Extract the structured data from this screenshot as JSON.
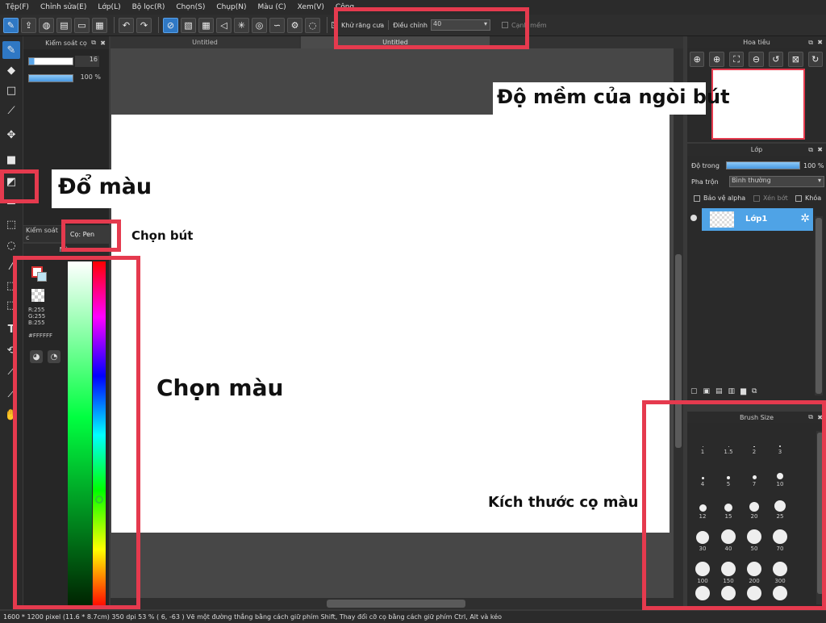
{
  "menu": [
    "Tệp(F)",
    "Chỉnh sửa(E)",
    "Lớp(L)",
    "Bộ lọc(R)",
    "Chọn(S)",
    "Chụp(N)",
    "Màu (C)",
    "Xem(V)",
    "Công"
  ],
  "toolbar": {
    "antialias_label": "Khử răng cưa",
    "adjust_label": "Điều chỉnh",
    "adjust_value": "40",
    "soft_edge_label": "Cạnh mềm"
  },
  "tabs": {
    "canvas_tab": "Untitled",
    "canvas_tab2": "Untitled"
  },
  "brush_control": {
    "title": "Kiểm soát cọ",
    "size_value": "16",
    "opacity_value": "100 %",
    "title_short": "Kiểm soát c",
    "brush_tab": "Cọ: Pen"
  },
  "color_panel": {
    "title": "Màu",
    "r": "R:255",
    "g": "G:255",
    "b": "B:255",
    "hex": "#FFFFFF",
    "fg_color": "#ffffff",
    "bg_color": "#ffffff"
  },
  "navigator": {
    "title": "Hoa tiêu"
  },
  "layer_panel": {
    "title": "Lớp",
    "opacity_label": "Độ trong",
    "opacity_value": "100 %",
    "blend_label": "Pha trộn",
    "blend_value": "Bình thường",
    "protect_alpha": "Bảo vệ alpha",
    "clipping": "Xén bớt",
    "lock": "Khóa",
    "layer_name": "Lớp1"
  },
  "brush_size": {
    "title": "Brush Size",
    "sizes": [
      "1",
      "1.5",
      "2",
      "3",
      "4",
      "5",
      "7",
      "10",
      "12",
      "15",
      "20",
      "25",
      "30",
      "40",
      "50",
      "70",
      "100",
      "150",
      "200",
      "300"
    ]
  },
  "annotations": {
    "fill": "Đổ màu",
    "pick_brush": "Chọn bút",
    "pick_color": "Chọn màu",
    "softness": "Độ mềm của ngòi bút",
    "brush_size": "Kích thước cọ màu"
  },
  "status": {
    "text": "1600 * 1200 pixel   (11.6 * 8.7cm)   350 dpi   53 %   ( 6, -63 )   Vẽ một đường thẳng bằng cách giữ phím Shift, Thay đổi cỡ cọ bằng cách giữ phím Ctrl, Alt và kéo"
  },
  "colors": {
    "accent": "#2f78c4",
    "highlight_box": "#e53a4e"
  }
}
